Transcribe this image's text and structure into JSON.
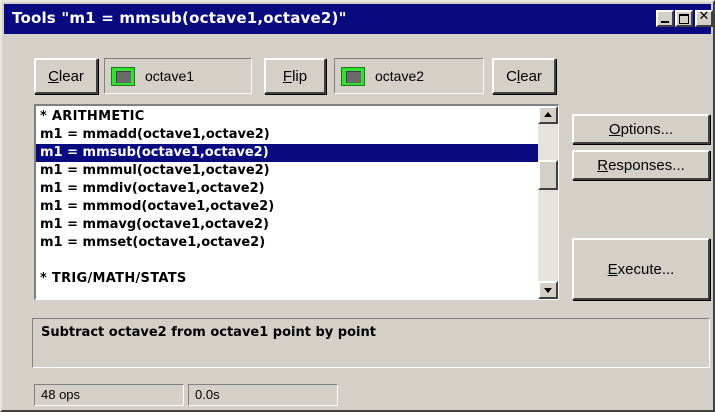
{
  "window": {
    "title": "Tools \"m1 = mmsub(octave1,octave2)\"",
    "close_glyph": "✕"
  },
  "toolbar": {
    "clear_left_label": "Clear",
    "channel1_label": "octave1",
    "flip_label": "Flip",
    "channel2_label": "octave2",
    "clear_right_label": "Clear",
    "channel_swatch_color": "#34e034"
  },
  "function_list": {
    "items": [
      {
        "text": "* ARITHMETIC",
        "selected": false,
        "header": true
      },
      {
        "text": "m1 = mmadd(octave1,octave2)",
        "selected": false,
        "header": false
      },
      {
        "text": "m1 = mmsub(octave1,octave2)",
        "selected": true,
        "header": false
      },
      {
        "text": "m1 = mmmul(octave1,octave2)",
        "selected": false,
        "header": false
      },
      {
        "text": "m1 = mmdiv(octave1,octave2)",
        "selected": false,
        "header": false
      },
      {
        "text": "m1 = mmmod(octave1,octave2)",
        "selected": false,
        "header": false
      },
      {
        "text": "m1 = mmavg(octave1,octave2)",
        "selected": false,
        "header": false
      },
      {
        "text": "m1 = mmset(octave1,octave2)",
        "selected": false,
        "header": false
      },
      {
        "text": "",
        "selected": false,
        "header": false
      },
      {
        "text": "* TRIG/MATH/STATS",
        "selected": false,
        "header": true
      }
    ],
    "selection_color": "#0a0a80"
  },
  "side_buttons": {
    "options_label": "Options...",
    "responses_label": "Responses...",
    "execute_label": "Execute..."
  },
  "description": {
    "text": "Subtract octave2 from octave1 point by point"
  },
  "status": {
    "ops": "48 ops",
    "time": "0.0s"
  },
  "colors": {
    "titlebar": "#0a0a80",
    "face": "#d4d0c8"
  }
}
